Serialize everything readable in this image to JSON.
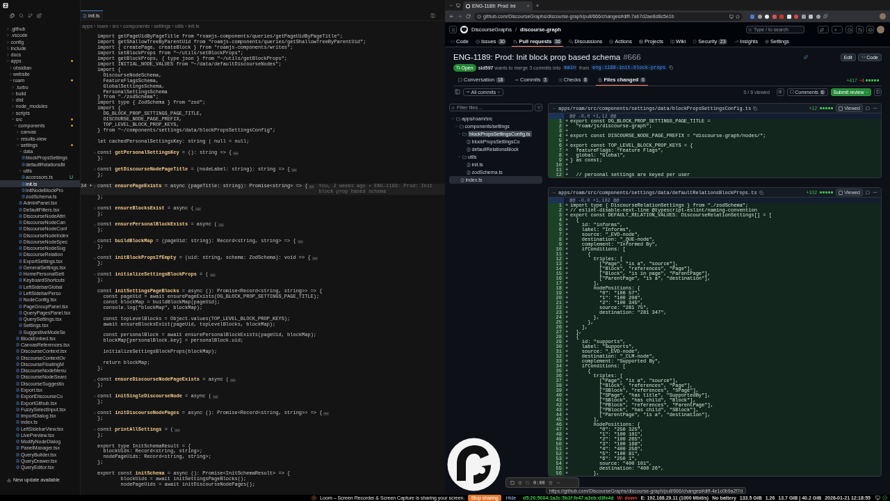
{
  "editor": {
    "sidebar": {
      "tree": [
        {
          "kind": "folder",
          "name": ".github",
          "expanded": false,
          "selected": false,
          "modified": false
        },
        {
          "kind": "folder",
          "name": ".vscode",
          "expanded": false,
          "selected": false,
          "modified": false
        },
        {
          "kind": "folder",
          "name": "config",
          "expanded": false,
          "selected": false,
          "modified": false
        },
        {
          "kind": "folder",
          "name": "include",
          "expanded": false,
          "selected": false,
          "modified": false
        },
        {
          "kind": "folder",
          "name": "docs",
          "expanded": false,
          "selected": false,
          "modified": false
        },
        {
          "kind": "folder",
          "name": "apps",
          "expanded": true,
          "selected": false,
          "modified": true,
          "children": [
            {
              "kind": "folder",
              "name": "obsidian",
              "expanded": false,
              "selected": false,
              "modified": false
            },
            {
              "kind": "folder",
              "name": "website",
              "expanded": false,
              "selected": false,
              "modified": false
            },
            {
              "kind": "folder",
              "name": "roam",
              "expanded": true,
              "selected": false,
              "modified": true,
              "children": [
                {
                  "kind": "folder",
                  "name": ".turbo",
                  "expanded": false,
                  "selected": false,
                  "modified": false
                },
                {
                  "kind": "folder",
                  "name": "build",
                  "expanded": false,
                  "selected": false,
                  "modified": false
                },
                {
                  "kind": "folder",
                  "name": "dist",
                  "expanded": false,
                  "selected": false,
                  "modified": false
                },
                {
                  "kind": "folder",
                  "name": "node_modules",
                  "expanded": false,
                  "selected": false,
                  "modified": false
                },
                {
                  "kind": "folder",
                  "name": "scripts",
                  "expanded": false,
                  "selected": false,
                  "modified": false
                },
                {
                  "kind": "folder",
                  "name": "src",
                  "expanded": true,
                  "selected": false,
                  "modified": true,
                  "children": [
                    {
                      "kind": "folder",
                      "name": "components",
                      "expanded": true,
                      "selected": false,
                      "modified": true,
                      "children": [
                        {
                          "kind": "folder",
                          "name": "canvas",
                          "expanded": false,
                          "selected": false,
                          "modified": false
                        },
                        {
                          "kind": "folder",
                          "name": "results-view",
                          "expanded": false,
                          "selected": false,
                          "modified": false
                        },
                        {
                          "kind": "folder",
                          "name": "settings",
                          "expanded": true,
                          "selected": false,
                          "modified": true,
                          "children": [
                            {
                              "kind": "folder",
                              "name": "data",
                              "expanded": true,
                              "selected": false,
                              "modified": false,
                              "children": [
                                {
                                  "kind": "file",
                                  "name": "blockPropsSettings",
                                  "selected": false
                                },
                                {
                                  "kind": "file",
                                  "name": "defaultRelationsBl",
                                  "selected": false
                                }
                              ]
                            },
                            {
                              "kind": "folder",
                              "name": "utils",
                              "expanded": true,
                              "selected": false,
                              "modified": false,
                              "children": [
                                {
                                  "kind": "file",
                                  "name": "accessors.ts",
                                  "badge": "U",
                                  "selected": false
                                },
                                {
                                  "kind": "file",
                                  "name": "init.ts",
                                  "selected": true
                                },
                                {
                                  "kind": "file",
                                  "name": "initNodeBlockPro",
                                  "selected": false
                                },
                                {
                                  "kind": "file",
                                  "name": "zodSchema.ts",
                                  "selected": false
                                }
                              ]
                            },
                            {
                              "kind": "file",
                              "name": "AdminPanel.tsx",
                              "selected": false
                            },
                            {
                              "kind": "file",
                              "name": "DefaultFilters.tsx",
                              "selected": false
                            },
                            {
                              "kind": "file",
                              "name": "DiscourseNodeAttri",
                              "selected": false
                            },
                            {
                              "kind": "file",
                              "name": "DiscourseNodeCan",
                              "selected": false
                            },
                            {
                              "kind": "file",
                              "name": "DiscourseNodeConf",
                              "selected": false
                            },
                            {
                              "kind": "file",
                              "name": "DiscourseNodeIndex",
                              "selected": false
                            },
                            {
                              "kind": "file",
                              "name": "DiscourseNodeSpec",
                              "selected": false
                            },
                            {
                              "kind": "file",
                              "name": "DiscourseNodeSug",
                              "selected": false
                            },
                            {
                              "kind": "file",
                              "name": "DiscourseRelation",
                              "selected": false
                            },
                            {
                              "kind": "file",
                              "name": "ExportSettings.tsx",
                              "selected": false
                            },
                            {
                              "kind": "file",
                              "name": "GeneralSettings.tsx",
                              "selected": false
                            },
                            {
                              "kind": "file",
                              "name": "HomePersonalSett",
                              "selected": false
                            },
                            {
                              "kind": "file",
                              "name": "KeyboardShortcuts",
                              "selected": false
                            },
                            {
                              "kind": "file",
                              "name": "LeftSidebarGlobal",
                              "selected": false
                            },
                            {
                              "kind": "file",
                              "name": "LeftSidebarPerso",
                              "selected": false
                            },
                            {
                              "kind": "file",
                              "name": "NodeConfig.tsx",
                              "selected": false
                            },
                            {
                              "kind": "file",
                              "name": "PageGroupPanel.tsx",
                              "selected": false
                            },
                            {
                              "kind": "file",
                              "name": "QueryPagesPanel.tsx",
                              "selected": false
                            },
                            {
                              "kind": "file",
                              "name": "QuerySettings.tsx",
                              "selected": false
                            },
                            {
                              "kind": "file",
                              "name": "Settings.tsx",
                              "selected": false
                            },
                            {
                              "kind": "file",
                              "name": "SuggestiveModeSe",
                              "selected": false
                            }
                          ]
                        },
                        {
                          "kind": "file",
                          "name": "BlockEmbed.tsx",
                          "selected": false
                        },
                        {
                          "kind": "file",
                          "name": "CanvasReferences.tsx",
                          "selected": false
                        },
                        {
                          "kind": "file",
                          "name": "DiscourseContext.tsx",
                          "selected": false
                        },
                        {
                          "kind": "file",
                          "name": "DiscourseContextOv",
                          "selected": false
                        },
                        {
                          "kind": "file",
                          "name": "DiscourseFloatingM",
                          "selected": false
                        },
                        {
                          "kind": "file",
                          "name": "DiscourseNodeMenu",
                          "selected": false
                        },
                        {
                          "kind": "file",
                          "name": "DiscourseNodeSearc",
                          "selected": false
                        },
                        {
                          "kind": "file",
                          "name": "DiscourseSuggestio",
                          "selected": false
                        },
                        {
                          "kind": "file",
                          "name": "Export.tsx",
                          "selected": false
                        },
                        {
                          "kind": "file",
                          "name": "ExportDiscourseCo",
                          "selected": false
                        },
                        {
                          "kind": "file",
                          "name": "ExportGithub.tsx",
                          "selected": false
                        },
                        {
                          "kind": "file",
                          "name": "FuzzySelectInput.tsx",
                          "selected": false
                        },
                        {
                          "kind": "file",
                          "name": "ImportDialog.tsx",
                          "selected": false
                        },
                        {
                          "kind": "file",
                          "name": "index.ts",
                          "selected": false
                        },
                        {
                          "kind": "file",
                          "name": "LeftSidebarView.tsx",
                          "selected": false
                        },
                        {
                          "kind": "file",
                          "name": "LivePreview.tsx",
                          "selected": false
                        },
                        {
                          "kind": "file",
                          "name": "ModifyNodeDialog",
                          "selected": false
                        },
                        {
                          "kind": "file",
                          "name": "PanelManager.tsx",
                          "selected": false
                        },
                        {
                          "kind": "file",
                          "name": "QueryBuilder.tsx",
                          "selected": false
                        },
                        {
                          "kind": "file",
                          "name": "QueryDrawer.tsx",
                          "selected": false
                        },
                        {
                          "kind": "file",
                          "name": "QueryEditor.tsx",
                          "selected": false
                        }
                      ]
                    }
                  ]
                }
              ]
            }
          ]
        }
      ],
      "update_notice": "New update available"
    },
    "tabs": [
      {
        "label": "init.ts",
        "selected": true
      }
    ],
    "breadcrumb": "apps › roam › src › components › settings › utils › init.ts",
    "lines": [
      {
        "text": "import getPageUidByPageTitle from \"roamjs-components/queries/getPageUidByPageTitle\";",
        "folded": false,
        "current": false
      },
      {
        "text": "import getShallowTreeByParentUid from \"roamjs-components/queries/getShallowTreeByParentUid\";",
        "folded": false,
        "current": false
      },
      {
        "text": "import { createPage, createBlock } from \"roamjs-components/writes\";",
        "folded": false,
        "current": false
      },
      {
        "text": "import setBlockProps from \"~/utils/setBlockProps\";",
        "folded": false,
        "current": false
      },
      {
        "text": "import getBlockProps, { type json } from \"~/utils/getBlockProps\";",
        "folded": false,
        "current": false
      },
      {
        "text": "import INITIAL_NODE_VALUES from \"~/data/defaultDiscourseNodes\";",
        "folded": false,
        "current": false
      },
      {
        "text": "import {",
        "folded": false,
        "current": false
      },
      {
        "text": "  DiscourseNodeSchema,",
        "folded": false,
        "current": false
      },
      {
        "text": "  FeatureFlagsSchema,",
        "folded": false,
        "current": false
      },
      {
        "text": "  GlobalSettingsSchema,",
        "folded": false,
        "current": false
      },
      {
        "text": "  PersonalSettingsSchema",
        "folded": false,
        "current": false
      },
      {
        "text": "} from \"./zodSchema\";",
        "folded": false,
        "current": false
      },
      {
        "text": "import type { ZodSchema } from \"zod\";",
        "folded": false,
        "current": false
      },
      {
        "text": "import {",
        "folded": false,
        "current": false
      },
      {
        "text": "  DG_BLOCK_PROP_SETTINGS_PAGE_TITLE,",
        "folded": false,
        "current": false
      },
      {
        "text": "  DISCOURSE_NODE_PAGE_PREFIX,",
        "folded": false,
        "current": false
      },
      {
        "text": "  TOP_LEVEL_BLOCK_PROP_KEYS,",
        "folded": false,
        "current": false
      },
      {
        "text": "} from \"~/components/settings/data/blockPropsSettingsConfig\";",
        "folded": false,
        "current": false
      },
      {
        "folded": false,
        "current": false
      },
      {
        "text": "let cachedPersonalSettingsKey: string | null = null;",
        "folded": false,
        "current": false
      },
      {
        "folded": false,
        "current": false
      },
      {
        "text": "const **getPersonalSettingsKey** = (): string => {",
        "folded": true,
        "current": false
      },
      {
        "text": "};",
        "folded": false,
        "current": false
      },
      {
        "folded": false,
        "current": false
      },
      {
        "text": "const **getDiscourseNodePageTitle** = (nodeLabel: string): string => {",
        "folded": true,
        "current": false
      },
      {
        "text": "};",
        "folded": false,
        "current": false
      },
      {
        "folded": false,
        "current": false
      },
      {
        "text": "const **ensurePageExists** = async (pageTitle: string): Promise<string> => {",
        "folded": true,
        "current": true,
        "gutter": "34 +",
        "blame": "You, 2 weeks ago • ENG-1189: Prod: Init block prop based schema"
      },
      {
        "text": "};",
        "folded": false,
        "current": false
      },
      {
        "folded": false,
        "current": false
      },
      {
        "text": "const **ensureBlocksExist** = async (",
        "folded": true,
        "current": false
      },
      {
        "text": "};",
        "folded": false,
        "current": false
      },
      {
        "folded": false,
        "current": false
      },
      {
        "text": "const **ensurePersonalBlockExists** = async (",
        "folded": true,
        "current": false
      },
      {
        "text": "};",
        "folded": false,
        "current": false
      },
      {
        "folded": false,
        "current": false
      },
      {
        "text": "const **buildBlockMap** = (pageUid: string): Record<string, string> => {",
        "folded": true,
        "current": false
      },
      {
        "text": "};",
        "folded": false,
        "current": false
      },
      {
        "folded": false,
        "current": false
      },
      {
        "text": "const **initBlockPropsIfEmpty** = (uid: string, schema: ZodSchema): void => {",
        "folded": true,
        "current": false
      },
      {
        "text": "};",
        "folded": false,
        "current": false
      },
      {
        "folded": false,
        "current": false
      },
      {
        "text": "const **initializeSettingsBlockProps** = (",
        "folded": true,
        "current": false
      },
      {
        "text": "};",
        "folded": false,
        "current": false
      },
      {
        "folded": false,
        "current": false
      },
      {
        "text": "const **initSettingsPageBlocks** = async (): Promise<Record<string, string>> => {",
        "folded": false,
        "current": false
      },
      {
        "text": "  const pageUid = await ensurePageExists(DG_BLOCK_PROP_SETTINGS_PAGE_TITLE);",
        "folded": false,
        "current": false
      },
      {
        "text": "  const blockMap = buildBlockMap(pageUid);",
        "folded": false,
        "current": false
      },
      {
        "text": "  console.log(\"blockMap\", blockMap);",
        "folded": false,
        "current": false
      },
      {
        "folded": false,
        "current": false
      },
      {
        "text": "  const topLevelBlocks = Object.values(TOP_LEVEL_BLOCK_PROP_KEYS);",
        "folded": false,
        "current": false
      },
      {
        "text": "  await ensureBlocksExist(pageUid, topLevelBlocks, blockMap);",
        "folded": false,
        "current": false
      },
      {
        "folded": false,
        "current": false
      },
      {
        "text": "  const personalBlock = await ensurePersonalBlockExists(pageUid, blockMap);",
        "folded": false,
        "current": false
      },
      {
        "text": "  blockMap[personalBlock.key] = personalBlock.uid;",
        "folded": false,
        "current": false
      },
      {
        "folded": false,
        "current": false
      },
      {
        "text": "  initializeSettingsBlockProps(blockMap);",
        "folded": false,
        "current": false
      },
      {
        "folded": false,
        "current": false
      },
      {
        "text": "  return blockMap;",
        "folded": false,
        "current": false
      },
      {
        "text": "};",
        "folded": false,
        "current": false
      },
      {
        "folded": false,
        "current": false
      },
      {
        "text": "const **ensureDiscourseNodePageExists** = async (",
        "folded": true,
        "current": false
      },
      {
        "text": "};",
        "folded": false,
        "current": false
      },
      {
        "folded": false,
        "current": false
      },
      {
        "text": "const **initSingleDiscourseNode** = async (",
        "folded": true,
        "current": false
      },
      {
        "text": "};",
        "folded": false,
        "current": false
      },
      {
        "folded": false,
        "current": false
      },
      {
        "text": "const **initDiscourseNodePages** = async (): Promise<Record<string, string>> => {",
        "folded": true,
        "current": false
      },
      {
        "text": "};",
        "folded": false,
        "current": false
      },
      {
        "folded": false,
        "current": false
      },
      {
        "text": "const **printAllSettings** = (",
        "folded": true,
        "current": false
      },
      {
        "text": "};",
        "folded": false,
        "current": false
      },
      {
        "folded": false,
        "current": false
      },
      {
        "text": "export type InitSchemaResult = {",
        "folded": false,
        "current": false
      },
      {
        "text": "  blockUids: Record<string, string>;",
        "folded": false,
        "current": false
      },
      {
        "text": "  nodePageUids: Record<string, string>;",
        "folded": false,
        "current": false
      },
      {
        "text": "};",
        "folded": false,
        "current": false
      },
      {
        "folded": false,
        "current": false
      },
      {
        "text": "export const **initSchema** = async (): Promise<InitSchemaResult> => {",
        "folded": false,
        "current": false
      },
      {
        "text": "        blockUids = await initSettingsPageBlocks();",
        "folded": false,
        "current": false
      },
      {
        "text": "        nodePageUids = await initDiscourseNodePages();",
        "folded": false,
        "current": false
      }
    ]
  },
  "browser": {
    "tabs": [
      {
        "title": "ENG-1189: Prod: Ini",
        "selected": true
      }
    ],
    "url": "github.com/DiscourseGraphs/discourse-graph/pull/666/changes#diff-7ab7d2ae8d8c5e1b",
    "github": {
      "owner": "DiscourseGraphs",
      "separator": "/",
      "repo": "discourse-graph",
      "search_placeholder": "Type / to search",
      "nav": [
        {
          "label": "Code",
          "selected": false
        },
        {
          "label": "Issues",
          "count": "30",
          "selected": false
        },
        {
          "label": "Pull requests",
          "count": "36",
          "selected": true
        },
        {
          "label": "Discussions",
          "selected": false
        },
        {
          "label": "Actions",
          "selected": false
        },
        {
          "label": "Projects",
          "selected": false
        },
        {
          "label": "Wiki",
          "selected": false
        },
        {
          "label": "Security",
          "count": "23",
          "selected": false
        },
        {
          "label": "Insights",
          "selected": false
        },
        {
          "label": "Settings",
          "selected": false
        }
      ],
      "pr": {
        "title": "ENG-1189: Prod: Init block prop based schema",
        "number": "#666",
        "actions": [
          "Edit",
          "Code"
        ],
        "state": "Open",
        "meta": {
          "text": "**sid597** wants to merge 3 commits into",
          "base": "main",
          "joiner": "from",
          "head": "eng-1189-init-block-props"
        },
        "tabs": [
          {
            "label": "Conversation",
            "count": "18",
            "selected": false
          },
          {
            "label": "Commits",
            "count": "3",
            "selected": false
          },
          {
            "label": "Checks",
            "count": "8",
            "selected": false
          },
          {
            "label": "Files changed",
            "count": "6",
            "selected": true
          }
        ],
        "diffstat": {
          "added": "+417",
          "removed": "−4"
        },
        "toolbar": {
          "commits": "All commits",
          "viewed": "0 / 6 viewed",
          "comments": "Comments",
          "comments_count": "6",
          "submit": "Submit review"
        },
        "filter_placeholder": "Filter files…",
        "file_tree": [
          {
            "kind": "folder",
            "name": "apps/roam/src",
            "expanded": true,
            "selected": false,
            "children": [
              {
                "kind": "folder",
                "name": "components/settings",
                "expanded": true,
                "selected": false,
                "children": [
                  {
                    "kind": "folder",
                    "tooltip": "blockPropsSettingsConfig.ts",
                    "expanded": true,
                    "selected": false,
                    "children": [
                      {
                        "kind": "file",
                        "name": "blockPropsSettingsCo",
                        "selected": false
                      },
                      {
                        "kind": "file",
                        "name": "defaultRelationsBlock",
                        "selected": false
                      }
                    ]
                  },
                  {
                    "kind": "folder",
                    "name": "utils",
                    "expanded": true,
                    "selected": false,
                    "children": [
                      {
                        "kind": "file",
                        "name": "init.ts",
                        "selected": false
                      },
                      {
                        "kind": "file",
                        "name": "zodSchema.ts",
                        "selected": false
                      }
                    ]
                  }
                ]
              },
              {
                "kind": "file",
                "name": "index.ts",
                "selected": true
              }
            ]
          }
        ],
        "files": [
          {
            "path": "apps/roam/src/components/settings/data/blockPropsSettingsConfig.ts",
            "additions": "+12",
            "viewed_label": "Viewed",
            "viewed": false,
            "hunk": "@@ -0,0 +1,12 @@",
            "lines": [
              {
                "n": "1",
                "sign": "+",
                "text": "export const DG_BLOCK_PROP_SETTINGS_PAGE_TITLE ="
              },
              {
                "n": "2",
                "sign": "+",
                "text": "  \"roam/js/discourse-graph\";"
              },
              {
                "n": "3",
                "sign": "+"
              },
              {
                "n": "4",
                "sign": "+",
                "text": "export const DISCOURSE_NODE_PAGE_PREFIX = \"discourse-graph/nodes/\";"
              },
              {
                "n": "5",
                "sign": "+"
              },
              {
                "n": "6",
                "sign": "+",
                "text": "export const TOP_LEVEL_BLOCK_PROP_KEYS = {"
              },
              {
                "n": "7",
                "sign": "+",
                "text": "  featureFlags: \"Feature Flags\","
              },
              {
                "n": "8",
                "sign": "+",
                "text": "  global: \"Global\","
              },
              {
                "n": "9",
                "sign": "+",
                "text": "} as const;"
              },
              {
                "n": "10",
                "sign": "+"
              },
              {
                "n": "11",
                "sign": "+"
              },
              {
                "n": "12",
                "sign": "+",
                "text": "  // personal settings are keyed per user"
              }
            ]
          },
          {
            "path": "apps/roam/src/components/settings/data/defaultRelationsBlockProps.ts",
            "additions": "+102",
            "viewed_label": "Viewed",
            "viewed": false,
            "hunk": "@@ -0,0 +1,102 @@",
            "lines": [
              {
                "n": "1",
                "sign": "+",
                "text": "import type { DiscourseRelationSettings } from \"./zodSchema\";"
              },
              {
                "n": "2",
                "sign": "+",
                "text": "// eslint-disable-next-line @typescript-eslint/naming-convention"
              },
              {
                "n": "3",
                "sign": "+",
                "text": "export const DEFAULT_RELATION_VALUES: DiscourseRelationSettings[] = ["
              },
              {
                "n": "4",
                "sign": "+",
                "text": "  {"
              },
              {
                "n": "5",
                "sign": "+",
                "text": "    id: \"informs\","
              },
              {
                "n": "6",
                "sign": "+",
                "text": "    label: \"Informs\","
              },
              {
                "n": "7",
                "sign": "+",
                "text": "    source: \"_EVD-node\","
              },
              {
                "n": "8",
                "sign": "+",
                "text": "    destination: \"_QUE-node\","
              },
              {
                "n": "9",
                "sign": "+",
                "text": "    complement: \"Informed By\","
              },
              {
                "n": "10",
                "sign": "+",
                "text": "    ifConditions: ["
              },
              {
                "n": "11",
                "sign": "+",
                "text": "      {"
              },
              {
                "n": "12",
                "sign": "+",
                "text": "        triples: ["
              },
              {
                "n": "13",
                "sign": "+",
                "text": "          [\"Page\", \"is a\", \"source\"],"
              },
              {
                "n": "14",
                "sign": "+",
                "text": "          [\"Block\", \"references\", \"Page\"],"
              },
              {
                "n": "15",
                "sign": "+",
                "text": "          [\"Block\", \"is in page\", \"ParentPage\"],"
              },
              {
                "n": "16",
                "sign": "+",
                "text": "          [\"ParentPage\", \"is a\", \"destination\"],"
              },
              {
                "n": "17",
                "sign": "+",
                "text": "        ],"
              },
              {
                "n": "18",
                "sign": "+",
                "text": "        nodePositions: {"
              },
              {
                "n": "19",
                "sign": "+",
                "text": "          \"0\": \"100 57\","
              },
              {
                "n": "20",
                "sign": "+",
                "text": "          \"1\": \"100 208\","
              },
              {
                "n": "21",
                "sign": "+",
                "text": "          \"2\": \"100 345\","
              },
              {
                "n": "22",
                "sign": "+",
                "text": "          source: \"281 75\","
              },
              {
                "n": "23",
                "sign": "+",
                "text": "          destination: \"281 347\","
              },
              {
                "n": "24",
                "sign": "+",
                "text": "        },"
              },
              {
                "n": "25",
                "sign": "+",
                "text": "      },"
              },
              {
                "n": "26",
                "sign": "+",
                "text": "    ],"
              },
              {
                "n": "27",
                "sign": "+",
                "text": "  },"
              },
              {
                "n": "28",
                "sign": "+",
                "text": "  {"
              },
              {
                "n": "29",
                "sign": "+",
                "text": "    id: \"supports\","
              },
              {
                "n": "30",
                "sign": "+",
                "text": "    label: \"Supports\","
              },
              {
                "n": "31",
                "sign": "+",
                "text": "    source: \"_EVD-node\","
              },
              {
                "n": "32",
                "sign": "+",
                "text": "    destination: \"_CLM-node\","
              },
              {
                "n": "33",
                "sign": "+",
                "text": "    complement: \"Supported By\","
              },
              {
                "n": "34",
                "sign": "+",
                "text": "    ifConditions: ["
              },
              {
                "n": "35",
                "sign": "+",
                "text": "      {"
              },
              {
                "n": "36",
                "sign": "+",
                "text": "        triples: ["
              },
              {
                "n": "37",
                "sign": "+",
                "text": "          [\"Page\", \"is a\", \"source\"],"
              },
              {
                "n": "38",
                "sign": "+",
                "text": "          [\"Block\", \"references\", \"Page\"],"
              },
              {
                "n": "39",
                "sign": "+",
                "text": "          [\"SBlock\", \"references\", \"SPage\"],"
              },
              {
                "n": "40",
                "sign": "+",
                "text": "          [\"SPage\", \"has title\", \"SupportedBy\"],"
              },
              {
                "n": "41",
                "sign": "+",
                "text": "          [\"SBlock\", \"has child\", \"Block\"],"
              },
              {
                "n": "42",
                "sign": "+",
                "text": "          [\"PBlock\", \"references\", \"ParentPage\"],"
              },
              {
                "n": "43",
                "sign": "+",
                "text": "          [\"PBlock\", \"has child\", \"SBlock\"],"
              },
              {
                "n": "44",
                "sign": "+",
                "text": "          [\"ParentPage\", \"is a\", \"destination\"],"
              },
              {
                "n": "45",
                "sign": "+",
                "text": "        ],"
              },
              {
                "n": "46",
                "sign": "+",
                "text": "        nodePositions: {"
              },
              {
                "n": "47",
                "sign": "+",
                "text": "          \"0\": \"250 325\","
              },
              {
                "n": "48",
                "sign": "+",
                "text": "          \"1\": \"100 101\","
              },
              {
                "n": "49",
                "sign": "+",
                "text": "          \"2\": \"100 265\","
              },
              {
                "n": "50",
                "sign": "+",
                "text": "          \"3\": \"100 168\","
              },
              {
                "n": "51",
                "sign": "+",
                "text": "          \"4\": \"400 256\","
              },
              {
                "n": "52",
                "sign": "+",
                "text": "          \"5\": \"100 81\","
              },
              {
                "n": "53",
                "sign": "+",
                "text": "          \"6\": \"250 1\","
              },
              {
                "n": "54",
                "sign": "+",
                "text": "          source: \"400 101\","
              },
              {
                "n": "55",
                "sign": "+",
                "text": "          destination: \"400 26\","
              },
              {
                "n": "56",
                "sign": "+",
                "text": "        },"
              }
            ]
          }
        ]
      }
    },
    "link_preview": "https://github.com/DiscourseGraphs/discourse-graph/pull/666/changes#diff-4e1c0b9a2f7d"
  },
  "recorder": {
    "timer": "0:00"
  },
  "sharing_bar": {
    "message": "Loom – Screen Recorder & Screen Capture is sharing your screen.",
    "stop": "Stop sharing",
    "hide": "Hide"
  },
  "status_bar": [
    {
      "text": "d5:20:5004:1a2c:5b1f:fe47:a3eb:d3fe4d",
      "color": "#3fcf4a"
    },
    {
      "text": "W: down",
      "color": "#e0443e"
    },
    {
      "text": "E: 192.168.29.11 (1000 Mbit/s)",
      "color": "#d8d8d8"
    },
    {
      "text": "No battery",
      "color": "#d8d8d8"
    },
    {
      "text": "133.5 GiB",
      "color": "#d8d8d8"
    },
    {
      "text": "1.26",
      "color": "#d8d8d8"
    },
    {
      "text": "13.7 GiB | 40.2 GiB",
      "color": "#d8d8d8"
    },
    {
      "text": "2026-01-21 12:18:55",
      "color": "#d8d8d8"
    }
  ]
}
